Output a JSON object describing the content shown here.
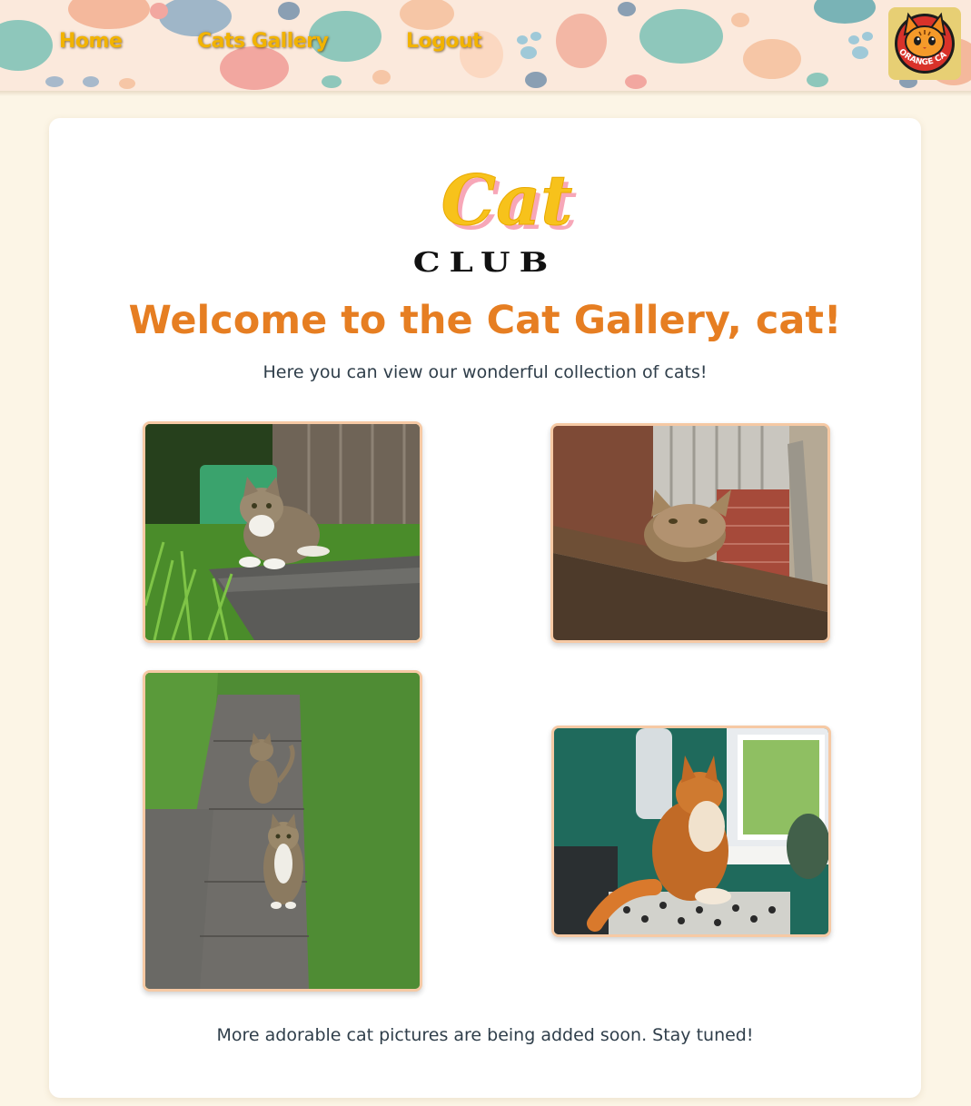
{
  "nav": {
    "home": "Home",
    "gallery": "Cats Gallery",
    "logout": "Logout"
  },
  "brand": {
    "badge_text": "ORANGE CAT",
    "badge_icon": "orange-cat-face-icon"
  },
  "logo": {
    "word": "Cat",
    "sub": "CLUB"
  },
  "page": {
    "title": "Welcome to the Cat Gallery, cat!",
    "intro": "Here you can view our wonderful collection of cats!",
    "footer_note": "More adorable cat pictures are being added soon. Stay tuned!"
  },
  "gallery": [
    {
      "id": "photo-1",
      "subject": "tabby cat on a garden wall"
    },
    {
      "id": "photo-2",
      "subject": "tabby cat on a wooden plank"
    },
    {
      "id": "photo-3",
      "subject": "two tabby cats on a garden path"
    },
    {
      "id": "photo-4",
      "subject": "orange long-haired cat by a window"
    }
  ],
  "colors": {
    "page_bg": "#fcf5e6",
    "card_bg": "#ffffff",
    "title": "#e67e22",
    "nav_text": "#f2b300",
    "photo_border": "#f6c9a4",
    "body_text": "#2f3e4a"
  }
}
